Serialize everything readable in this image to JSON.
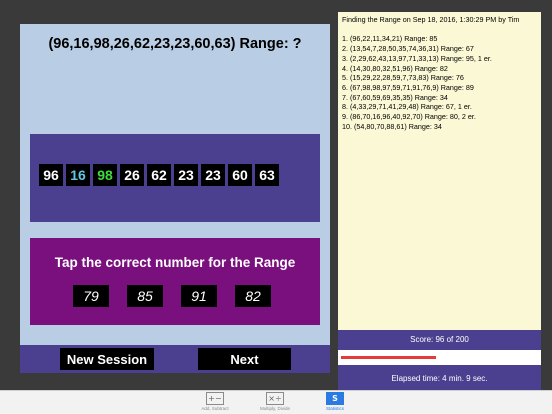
{
  "question": "(96,16,98,26,62,23,23,60,63) Range: ?",
  "numbers": [
    {
      "value": "96",
      "color": "#ffffff"
    },
    {
      "value": "16",
      "color": "#5ec8e6"
    },
    {
      "value": "98",
      "color": "#3cdc3c"
    },
    {
      "value": "26",
      "color": "#ffffff"
    },
    {
      "value": "62",
      "color": "#ffffff"
    },
    {
      "value": "23",
      "color": "#ffffff"
    },
    {
      "value": "23",
      "color": "#ffffff"
    },
    {
      "value": "60",
      "color": "#ffffff"
    },
    {
      "value": "63",
      "color": "#ffffff"
    }
  ],
  "answer_prompt": "Tap the correct number for the Range",
  "choices": [
    "79",
    "85",
    "91",
    "82"
  ],
  "buttons": {
    "new_session": "New Session",
    "next": "Next"
  },
  "history": {
    "title": "Finding the  Range  on Sep 18, 2016, 1:30:29 PM by Tim",
    "items": [
      "1.  (96,22,11,34,21) Range: 85",
      "2.  (13,54,7,28,50,35,74,36,31) Range: 67",
      "3.  (2,29,62,43,13,97,71,33,13) Range: 95, 1  er.",
      "4.  (14,30,80,32,51,96) Range: 82",
      "5.  (15,29,22,28,59,7,73,83) Range: 76",
      "6.  (67,98,98,97,59,71,91,76,9) Range: 89",
      "7.  (67,60,59,69,35,35) Range: 34",
      "8.  (4,33,29,71,41,29,48) Range: 67, 1  er.",
      "9.  (86,70,16,96,40,92,70) Range: 80, 2  er.",
      "10.  (54,80,70,88,61) Range: 34"
    ]
  },
  "score": {
    "text": "Score: 96 of 200",
    "progress_fraction": 0.48
  },
  "elapsed": "Elapsed time:   4 min.  9 sec.",
  "tabs": [
    {
      "label": "Add, Subtract",
      "icon": "add-subtract-icon",
      "glyph": "+−",
      "active": false
    },
    {
      "label": "Multiply, Divide",
      "icon": "multiply-divide-icon",
      "glyph": "×÷",
      "active": false
    },
    {
      "label": "Statistics",
      "icon": "statistics-icon",
      "glyph": "S",
      "active": true
    }
  ],
  "colors": {
    "accent_purple": "#4b3f8f",
    "answer_panel": "#7a0f7e",
    "left_bg": "#b9cde4",
    "history_bg": "#fbf8d6",
    "tab_active": "#2a7ae2"
  }
}
